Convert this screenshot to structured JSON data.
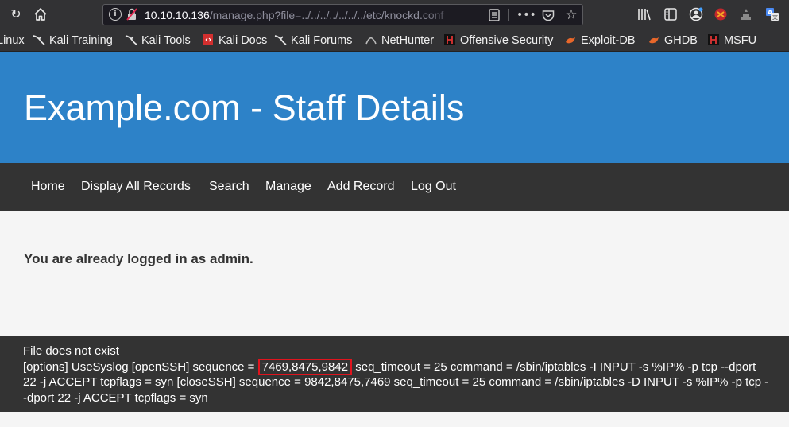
{
  "browser": {
    "url_host": "10.10.10.136",
    "url_path": "/manage.php?file=../../../../../../../etc/knockd.conf",
    "icons": {
      "back": "reload-icon",
      "home": "home-icon",
      "info": "info-icon",
      "lock": "insecure-lock-icon",
      "reader": "reader-view-icon",
      "more": "more-actions-icon",
      "pocket": "pocket-icon",
      "star": "bookmark-star-icon",
      "library": "library-icon",
      "sidebar": "sidebar-icon",
      "account": "account-icon",
      "ext1": "extension-icon",
      "ext2": "extension-icon",
      "ext3": "translate-icon"
    }
  },
  "bookmarks": [
    {
      "label": "Linux",
      "icon": "kali-icon"
    },
    {
      "label": "Kali Training",
      "icon": "kali-dragon-icon"
    },
    {
      "label": "Kali Tools",
      "icon": "kali-dragon-icon"
    },
    {
      "label": "Kali Docs",
      "icon": "kali-docs-icon"
    },
    {
      "label": "Kali Forums",
      "icon": "kali-dragon-icon"
    },
    {
      "label": "NetHunter",
      "icon": "nethunter-icon"
    },
    {
      "label": "Offensive Security",
      "icon": "offsec-icon"
    },
    {
      "label": "Exploit-DB",
      "icon": "exploitdb-icon"
    },
    {
      "label": "GHDB",
      "icon": "ghdb-icon"
    },
    {
      "label": "MSFU",
      "icon": "msfu-icon"
    }
  ],
  "page": {
    "title": "Example.com - Staff Details",
    "nav": [
      "Home",
      "Display All Records",
      "Search",
      "Manage",
      "Add Record",
      "Log Out"
    ],
    "message": "You are already logged in as admin.",
    "footer": {
      "line1": "File does not exist",
      "pre": "[options] UseSyslog [openSSH] sequence = ",
      "highlight": "7469,8475,9842",
      "post": " seq_timeout = 25 command = /sbin/iptables -I INPUT -s %IP% -p tcp --dport 22 -j ACCEPT tcpflags = syn [closeSSH] sequence = 9842,8475,7469 seq_timeout = 25 command = /sbin/iptables -D INPUT -s %IP% -p tcp --dport 22 -j ACCEPT tcpflags = syn"
    }
  },
  "colors": {
    "header_bg": "#2d82c8",
    "nav_bg": "#333333",
    "highlight_border": "#e0141e",
    "page_bg": "#f5f5f5"
  }
}
